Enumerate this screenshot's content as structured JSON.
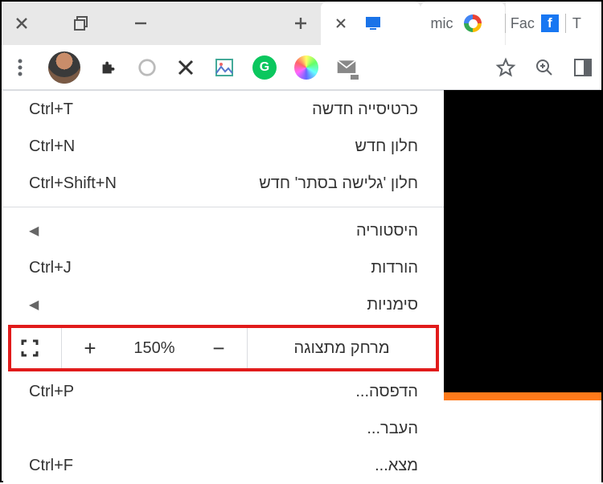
{
  "tabs": {
    "tab1": {
      "tooltip": "current-tab"
    },
    "tab2": {
      "label": "mic"
    },
    "tab3": {
      "label": "Fac"
    },
    "tab4": {
      "label": "T"
    }
  },
  "menu": {
    "new_tab": {
      "label": "כרטיסייה חדשה",
      "shortcut": "Ctrl+T"
    },
    "new_window": {
      "label": "חלון חדש",
      "shortcut": "Ctrl+N"
    },
    "incognito": {
      "label": "חלון 'גלישה בסתר' חדש",
      "shortcut": "Ctrl+Shift+N"
    },
    "history": {
      "label": "היסטוריה"
    },
    "downloads": {
      "label": "הורדות",
      "shortcut": "Ctrl+J"
    },
    "bookmarks": {
      "label": "סימניות"
    },
    "zoom": {
      "label": "מרחק מתצוגה",
      "level": "150%",
      "plus": "+",
      "minus": "−"
    },
    "print": {
      "label": "הדפסה...",
      "shortcut": "Ctrl+P"
    },
    "cast": {
      "label": "העבר..."
    },
    "find": {
      "label": "מצא...",
      "shortcut": "Ctrl+F"
    }
  }
}
